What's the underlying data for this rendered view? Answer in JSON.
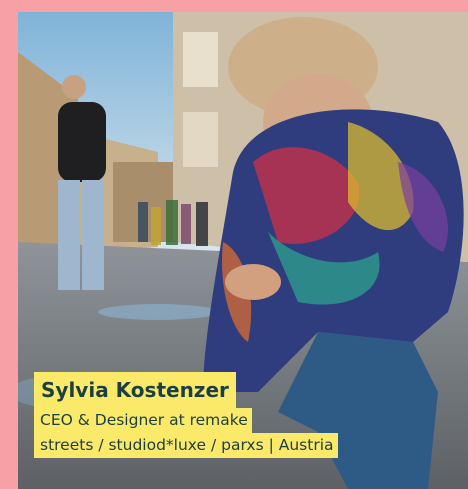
{
  "background_color": "#f7a0a6",
  "caption_highlight_color": "#fbe96a",
  "caption_text_color": "#1c3f44",
  "person": {
    "name": "Sylvia Kostenzer",
    "title_line_1": "CEO & Designer at remake",
    "title_line_2": "streets / studiod*luxe / parxs | Austria"
  },
  "photo": {
    "subject": "woman in multicolor jacket crouching and drawing with chalk on a city street",
    "icon": "photo"
  }
}
